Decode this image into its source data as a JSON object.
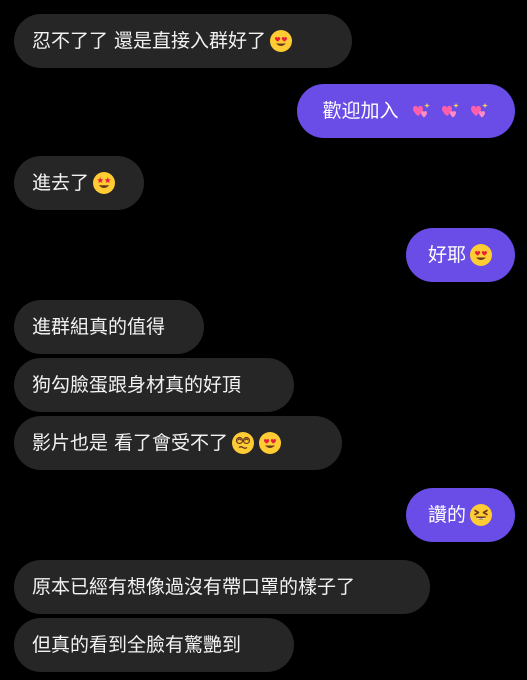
{
  "messages": [
    {
      "side": "received",
      "text": "忍不了了 還是直接入群好了",
      "emojis": [
        "heart-eyes"
      ]
    },
    {
      "side": "sent",
      "text": "歡迎加入",
      "emojis": [
        "sparkling-hearts",
        "sparkling-hearts",
        "sparkling-hearts"
      ]
    },
    {
      "side": "received",
      "text": "進去了",
      "emojis": [
        "star-struck"
      ]
    },
    {
      "side": "sent",
      "text": "好耶",
      "emojis": [
        "heart-eyes"
      ]
    },
    {
      "side": "received",
      "text": "進群組真的值得",
      "emojis": []
    },
    {
      "side": "received",
      "text": "狗勾臉蛋跟身材真的好頂",
      "emojis": []
    },
    {
      "side": "received",
      "text": "影片也是 看了會受不了",
      "emojis": [
        "dizzy-face",
        "heart-eyes"
      ]
    },
    {
      "side": "sent",
      "text": "讚的",
      "emojis": [
        "grinning-squinting"
      ]
    },
    {
      "side": "received",
      "text": "原本已經有想像過沒有帶口罩的樣子了",
      "emojis": []
    },
    {
      "side": "received",
      "text": "但真的看到全臉有驚艷到",
      "emojis": []
    }
  ],
  "colors": {
    "background": "#000000",
    "received_bubble": "#262626",
    "sent_bubble": "#6a4de6",
    "text": "#f2f2f2"
  }
}
